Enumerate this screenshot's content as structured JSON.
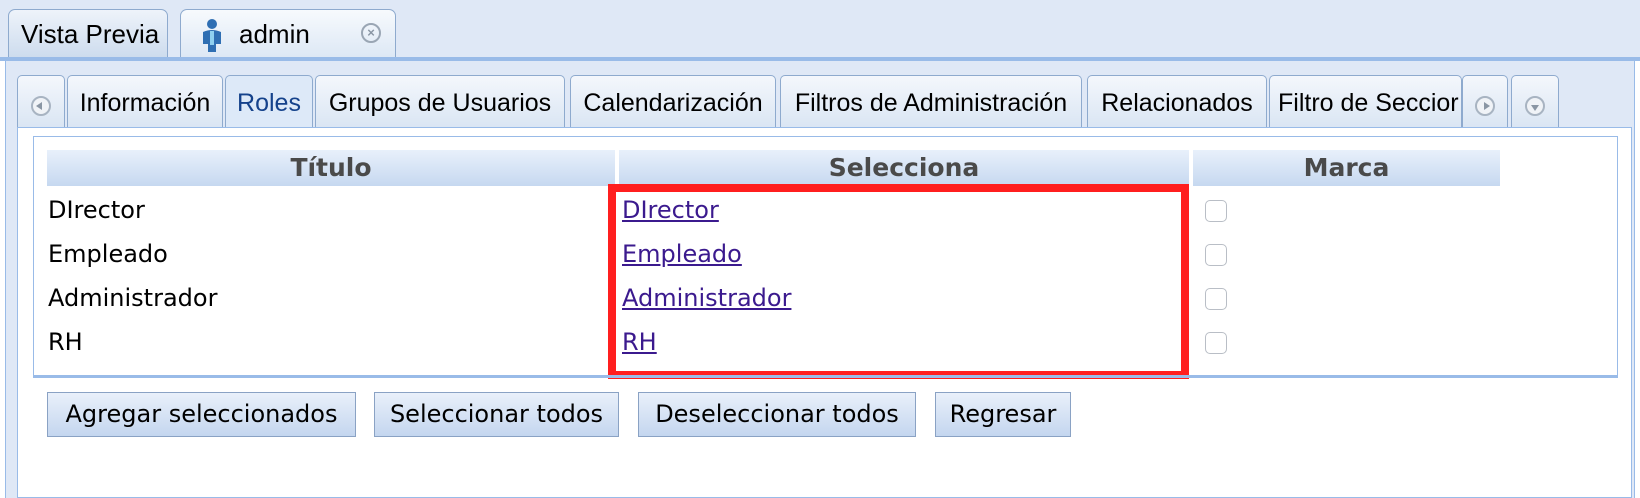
{
  "top_tabs": [
    {
      "label": "Vista Previa"
    },
    {
      "label": "admin"
    }
  ],
  "section_tabs": [
    {
      "label": "Información"
    },
    {
      "label": "Roles"
    },
    {
      "label": "Grupos de Usuarios"
    },
    {
      "label": "Calendarización"
    },
    {
      "label": "Filtros de Administración"
    },
    {
      "label": "Relacionados"
    },
    {
      "label": "Filtro de Seccior"
    }
  ],
  "active_tab": "Roles",
  "grid": {
    "columns": [
      "Título",
      "Selecciona",
      "Marca"
    ],
    "rows": [
      {
        "titulo": "DIrector",
        "selecciona": "DIrector",
        "marca": false
      },
      {
        "titulo": "Empleado",
        "selecciona": "Empleado",
        "marca": false
      },
      {
        "titulo": "Administrador",
        "selecciona": "Administrador",
        "marca": false
      },
      {
        "titulo": "RH",
        "selecciona": "RH",
        "marca": false
      }
    ]
  },
  "buttons": {
    "add_selected": "Agregar seleccionados",
    "select_all": "Seleccionar todos",
    "deselect_all": "Deseleccionar todos",
    "back": "Regresar"
  },
  "colors": {
    "highlight": "#ff1f1f",
    "link": "#3b1a8e",
    "header_bg": "#dfe8f6"
  },
  "icons": [
    "user-icon",
    "close-icon",
    "scroll-left-icon",
    "scroll-right-icon",
    "tab-menu-icon"
  ]
}
